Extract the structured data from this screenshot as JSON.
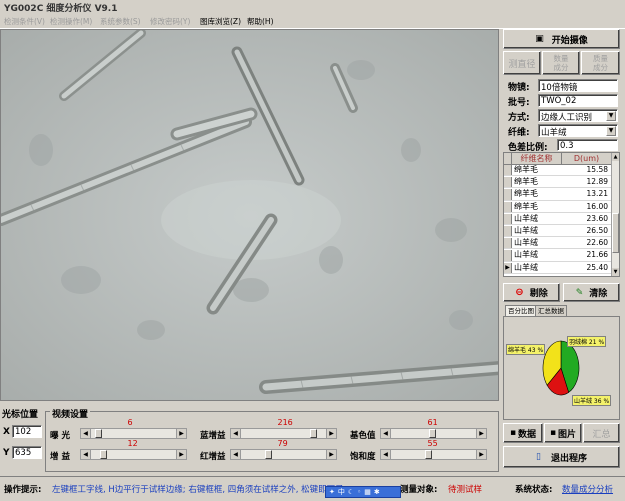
{
  "window": {
    "title": "YG002C 细度分析仪 V9.1"
  },
  "menu": [
    {
      "label": "检测条件(V)",
      "enabled": false
    },
    {
      "label": "检测操作(M)",
      "enabled": false
    },
    {
      "label": "系统参数(S)",
      "enabled": false
    },
    {
      "label": "修改密码(Y)",
      "enabled": false
    },
    {
      "label": "图库浏览(Z)",
      "enabled": true
    },
    {
      "label": "帮助(H)",
      "enabled": true
    }
  ],
  "panel": {
    "start_button": "开始摄像",
    "measure_diameter_button": "测直径",
    "count_components_button": "数量\n成分",
    "weight_components_button": "质量\n成分",
    "objective_label": "物镜:",
    "objective_value": "10倍物镜",
    "batch_label": "批号:",
    "batch_value": "TWO_02",
    "method_label": "方式:",
    "method_value": "边缘人工识别",
    "fiber_label": "纤维:",
    "fiber_value": "山羊绒",
    "color_diff_label": "色差比例:",
    "color_diff_value": "0.3",
    "delete_button": "剔除",
    "clear_button": "清除",
    "tabs": [
      "百分比图",
      "汇总数据"
    ],
    "data_button": "数据",
    "image_button": "图片",
    "summary_button": "汇总",
    "exit_button": "退出程序"
  },
  "table": {
    "headers": [
      "纤维名称",
      "D(um)"
    ],
    "rows": [
      {
        "name": "绵羊毛",
        "value": "15.58"
      },
      {
        "name": "绵羊毛",
        "value": "12.89"
      },
      {
        "name": "绵羊毛",
        "value": "13.21"
      },
      {
        "name": "绵羊毛",
        "value": "16.00"
      },
      {
        "name": "山羊绒",
        "value": "23.60"
      },
      {
        "name": "山羊绒",
        "value": "26.50"
      },
      {
        "name": "山羊绒",
        "value": "22.60"
      },
      {
        "name": "山羊绒",
        "value": "21.66"
      },
      {
        "name": "山羊绒",
        "value": "25.40"
      }
    ]
  },
  "pie": {
    "label_left": "绵羊毛 43 %",
    "label_top_right": "羽绒棉 21 %",
    "label_bottom_right": "山羊绒 36 %",
    "slices": [
      {
        "name": "绵羊毛",
        "value": 43,
        "color": "#22aa22"
      },
      {
        "name": "羽绒棉",
        "value": 21,
        "color": "#dd1111"
      },
      {
        "name": "山羊绒",
        "value": 36,
        "color": "#f2e21a"
      }
    ]
  },
  "cursor": {
    "title": "光标位置",
    "x_label": "X",
    "x_value": "102",
    "y_label": "Y",
    "y_value": "635"
  },
  "video": {
    "title": "视频设置",
    "sliders": [
      {
        "label": "曝   光",
        "value": "6",
        "level": 0.06
      },
      {
        "label": "蓝增益",
        "value": "216",
        "level": 0.85
      },
      {
        "label": "基色值",
        "value": "61",
        "level": 0.48
      },
      {
        "label": "增   益",
        "value": "12",
        "level": 0.12
      },
      {
        "label": "红增益",
        "value": "79",
        "level": 0.31
      },
      {
        "label": "饱和度",
        "value": "55",
        "level": 0.43
      }
    ]
  },
  "status": {
    "hint_label": "操作提示:",
    "hint_text": "左键框工字线, H边平行于试样边缘; 右键框框, 四角须在试样之外, 松键即可录",
    "target_label": "测量对象:",
    "target_value": "待测试样",
    "system_label": "系统状态:",
    "system_value": "数量成分分析"
  },
  "colors": {
    "accent_red": "#cc0000",
    "link_blue": "#1a3fbf",
    "panel": "#d4d0c8"
  }
}
